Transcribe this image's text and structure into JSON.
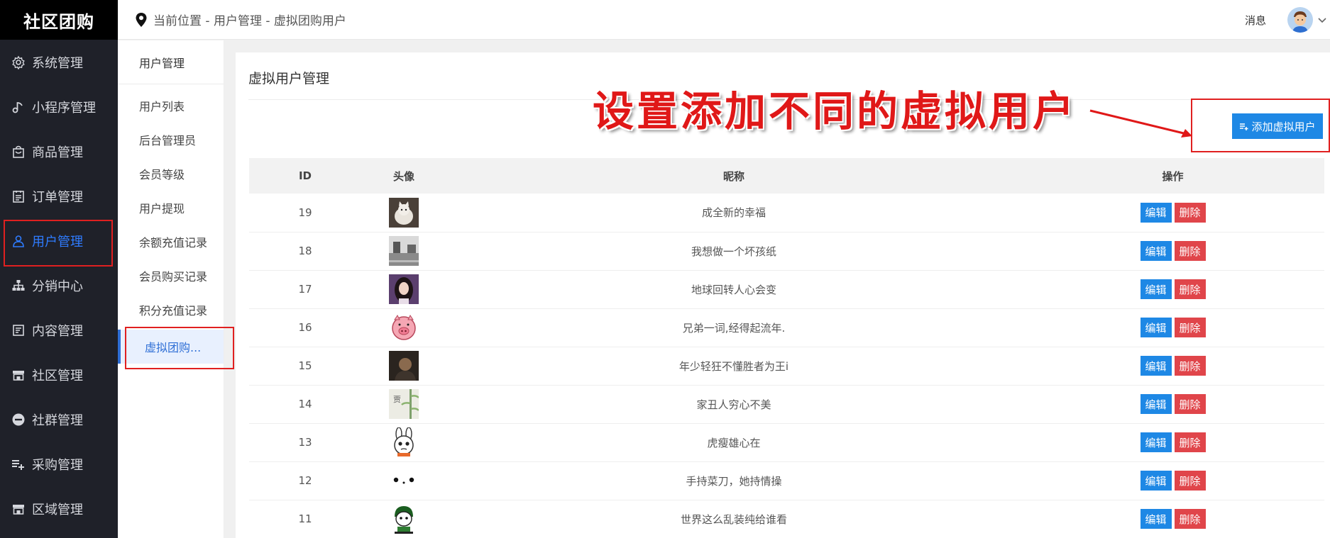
{
  "app": {
    "title": "社区团购"
  },
  "sidebar": {
    "items": [
      {
        "label": "系统管理",
        "icon": "gear-icon"
      },
      {
        "label": "小程序管理",
        "icon": "music-note-icon"
      },
      {
        "label": "商品管理",
        "icon": "bag-icon"
      },
      {
        "label": "订单管理",
        "icon": "clipboard-icon"
      },
      {
        "label": "用户管理",
        "icon": "user-icon",
        "active": true
      },
      {
        "label": "分销中心",
        "icon": "hierarchy-icon"
      },
      {
        "label": "内容管理",
        "icon": "document-icon"
      },
      {
        "label": "社区管理",
        "icon": "store-icon"
      },
      {
        "label": "社群管理",
        "icon": "minus-circle-icon"
      },
      {
        "label": "采购管理",
        "icon": "list-add-icon"
      },
      {
        "label": "区域管理",
        "icon": "store-icon"
      }
    ]
  },
  "header": {
    "breadcrumb": "当前位置 - 用户管理 - 虚拟团购用户",
    "messages_label": "消息"
  },
  "subnav": {
    "title": "用户管理",
    "items": [
      {
        "label": "用户列表"
      },
      {
        "label": "后台管理员"
      },
      {
        "label": "会员等级"
      },
      {
        "label": "用户提现"
      },
      {
        "label": "余额充值记录"
      },
      {
        "label": "会员购买记录"
      },
      {
        "label": "积分充值记录"
      },
      {
        "label": "虚拟团购...",
        "active": true
      }
    ]
  },
  "main": {
    "title": "虚拟用户管理",
    "add_button_label": "添加虚拟用户",
    "annotation": "设置添加不同的虚拟用户"
  },
  "table": {
    "headers": [
      "ID",
      "头像",
      "昵称",
      "操作"
    ],
    "edit_label": "编辑",
    "delete_label": "删除",
    "rows": [
      {
        "id": "19",
        "nickname": "成全新的幸福",
        "avatar": "cat-photo"
      },
      {
        "id": "18",
        "nickname": "我想做一个坏孩纸",
        "avatar": "street-photo"
      },
      {
        "id": "17",
        "nickname": "地球回转人心会变",
        "avatar": "girl-photo"
      },
      {
        "id": "16",
        "nickname": "兄弟一词,经得起流年.",
        "avatar": "pig-cartoon"
      },
      {
        "id": "15",
        "nickname": "年少轻狂不懂胜者为王i",
        "avatar": "dark-portrait"
      },
      {
        "id": "14",
        "nickname": "家丑人穷心不美",
        "avatar": "bamboo-art"
      },
      {
        "id": "13",
        "nickname": "虎瘦雄心在",
        "avatar": "rabbit-cartoon"
      },
      {
        "id": "12",
        "nickname": "手持菜刀，她持情操",
        "avatar": "dots-face"
      },
      {
        "id": "11",
        "nickname": "世界这么乱装纯给谁看",
        "avatar": "boy-cartoon"
      }
    ]
  },
  "colors": {
    "sidebar_bg": "#1f2129",
    "accent_blue": "#1e88e5",
    "delete_red": "#e0454a",
    "highlight_red": "#e01818"
  }
}
